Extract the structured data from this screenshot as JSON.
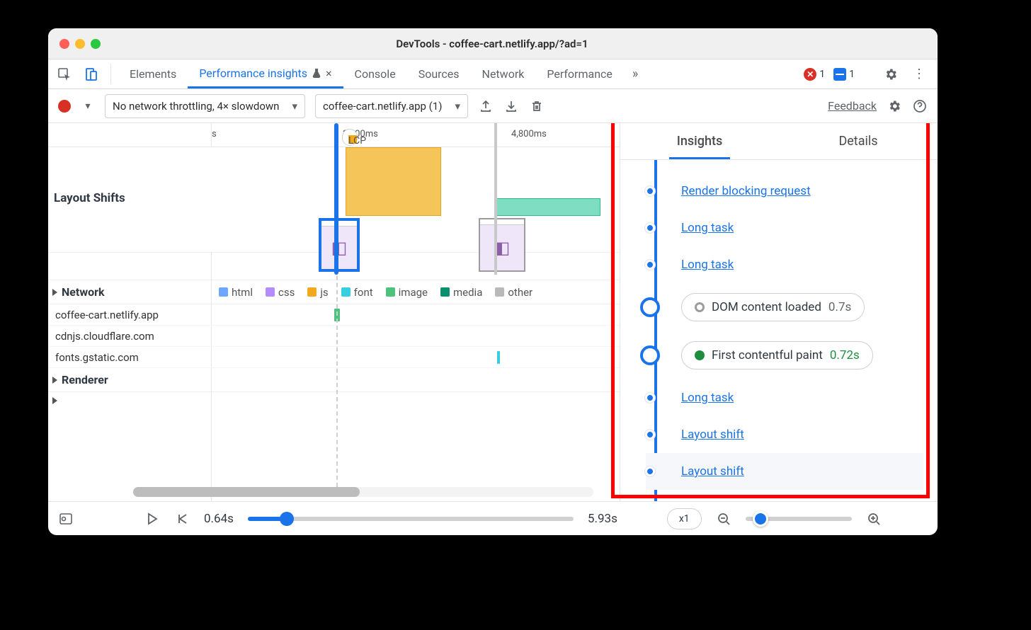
{
  "window_title": "DevTools - coffee-cart.netlify.app/?ad=1",
  "tabs": {
    "elements": "Elements",
    "perf_insights": "Performance insights",
    "console": "Console",
    "sources": "Sources",
    "network": "Network",
    "performance": "Performance"
  },
  "badges": {
    "errors": "1",
    "messages": "1"
  },
  "toolbar": {
    "throttle": "No network throttling, 4× slowdown",
    "page": "coffee-cart.netlify.app (1)",
    "feedback": "Feedback"
  },
  "ruler": {
    "unit_s": "s",
    "t3200": "3,200ms",
    "t4800": "4,800ms",
    "lcp": "LCP"
  },
  "tracks": {
    "layout_shifts": "Layout Shifts",
    "network": "Network",
    "renderer": "Renderer"
  },
  "legend": {
    "html": "html",
    "css": "css",
    "js": "js",
    "font": "font",
    "image": "image",
    "media": "media",
    "other": "other"
  },
  "legend_colors": {
    "html": "#6ea7ff",
    "css": "#b58cff",
    "js": "#f2aa1c",
    "font": "#35cfe0",
    "image": "#4dc27c",
    "media": "#0a8f6f",
    "other": "#b9b9b9"
  },
  "hosts": [
    "coffee-cart.netlify.app",
    "cdnjs.cloudflare.com",
    "fonts.gstatic.com"
  ],
  "side": {
    "tab_insights": "Insights",
    "tab_details": "Details",
    "items": [
      {
        "kind": "link",
        "label": "Render blocking request"
      },
      {
        "kind": "link",
        "label": "Long task"
      },
      {
        "kind": "link",
        "label": "Long task"
      },
      {
        "kind": "pill",
        "dot": "gray",
        "label": "DOM content loaded",
        "time": "0.7s"
      },
      {
        "kind": "pill",
        "dot": "green",
        "label": "First contentful paint",
        "time": "0.72s"
      },
      {
        "kind": "link",
        "label": "Long task"
      },
      {
        "kind": "link",
        "label": "Layout shift"
      },
      {
        "kind": "link",
        "label": "Layout shift"
      }
    ]
  },
  "footer": {
    "time_start": "0.64s",
    "time_end": "5.93s",
    "zoom": "x1"
  }
}
